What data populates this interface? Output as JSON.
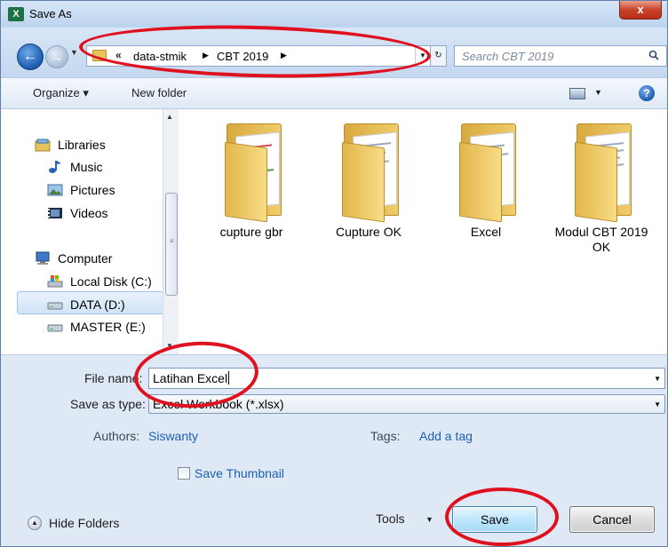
{
  "window": {
    "title": "Save As",
    "app_icon_text": "X",
    "close_label": "x"
  },
  "nav": {
    "breadcrumb_prefix": "«",
    "breadcrumbs": [
      "data-stmik",
      "CBT 2019"
    ],
    "search_placeholder": "Search CBT 2019"
  },
  "toolbar": {
    "organize_label": "Organize ▾",
    "new_folder_label": "New folder",
    "help_label": "?"
  },
  "sidebar": {
    "items": [
      {
        "label": "Libraries",
        "icon": "libraries-icon"
      },
      {
        "label": "Music",
        "icon": "music-icon"
      },
      {
        "label": "Pictures",
        "icon": "pictures-icon"
      },
      {
        "label": "Videos",
        "icon": "videos-icon"
      },
      {
        "label": "Computer",
        "icon": "computer-icon"
      },
      {
        "label": "Local Disk (C:)",
        "icon": "local-disk-icon"
      },
      {
        "label": "DATA (D:)",
        "icon": "drive-icon"
      },
      {
        "label": "MASTER (E:)",
        "icon": "drive-icon"
      }
    ],
    "selected": "DATA (D:)"
  },
  "folders": [
    {
      "name": "cupture gbr"
    },
    {
      "name": "Cupture OK"
    },
    {
      "name": "Excel"
    },
    {
      "name": "Modul CBT 2019 OK"
    }
  ],
  "form": {
    "file_name_label": "File name:",
    "file_name_value": "Latihan Excel",
    "save_type_label": "Save as type:",
    "save_type_value": "Excel Workbook (*.xlsx)",
    "authors_label": "Authors:",
    "authors_value": "Siswanty",
    "tags_label": "Tags:",
    "tags_value": "Add a tag",
    "thumbnail_label": "Save Thumbnail"
  },
  "footer": {
    "hide_folders_label": "Hide Folders",
    "tools_label": "Tools",
    "save_label": "Save",
    "cancel_label": "Cancel"
  },
  "colors": {
    "annotation": "#e0111f",
    "link": "#1c5fb5",
    "accent": "#3c7fb1"
  }
}
